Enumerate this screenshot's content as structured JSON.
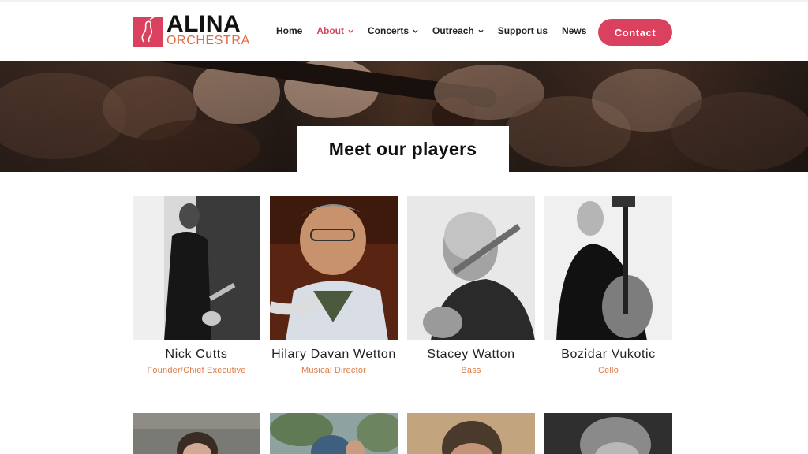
{
  "brand": {
    "name_line1": "ALINA",
    "name_line2": "ORCHESTRA",
    "accent": "#d9415f",
    "secondary": "#e06a43"
  },
  "nav": {
    "items": [
      {
        "label": "Home",
        "dropdown": false,
        "active": false
      },
      {
        "label": "About",
        "dropdown": true,
        "active": true
      },
      {
        "label": "Concerts",
        "dropdown": true,
        "active": false
      },
      {
        "label": "Outreach",
        "dropdown": true,
        "active": false
      },
      {
        "label": "Support us",
        "dropdown": false,
        "active": false
      },
      {
        "label": "News",
        "dropdown": false,
        "active": false
      }
    ],
    "contact_label": "Contact"
  },
  "banner": {
    "title": "Meet our players"
  },
  "players": [
    {
      "name": "Nick Cutts",
      "role": "Founder/Chief Executive"
    },
    {
      "name": "Hilary Davan Wetton",
      "role": "Musical Director"
    },
    {
      "name": "Stacey Watton",
      "role": "Bass"
    },
    {
      "name": "Bozidar Vukotic",
      "role": "Cello"
    }
  ]
}
